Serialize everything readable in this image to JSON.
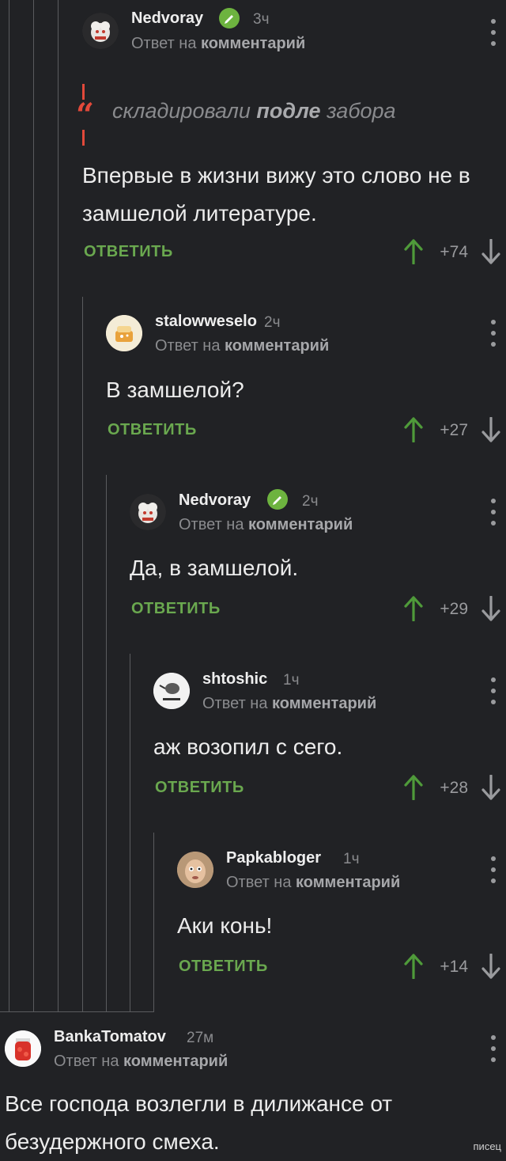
{
  "comments": [
    {
      "author": "Nedvoray",
      "time": "3ч",
      "reply_prefix": "Ответ на",
      "reply_target": "комментарий",
      "quote_pre": "складировали ",
      "quote_bold": "подле",
      "quote_post": " забора",
      "text": "Впервые в жизни вижу это слово не в замшелой литературе.",
      "reply_label": "ОТВЕТИТЬ",
      "score": "+74",
      "verified": true
    },
    {
      "author": "stalowweselo",
      "time": "2ч",
      "reply_prefix": "Ответ на",
      "reply_target": "комментарий",
      "text": "В замшелой?",
      "reply_label": "ОТВЕТИТЬ",
      "score": "+27"
    },
    {
      "author": "Nedvoray",
      "time": "2ч",
      "reply_prefix": "Ответ на",
      "reply_target": "комментарий",
      "text": "Да, в замшелой.",
      "reply_label": "ОТВЕТИТЬ",
      "score": "+29",
      "verified": true
    },
    {
      "author": "shtoshic",
      "time": "1ч",
      "reply_prefix": "Ответ на",
      "reply_target": "комментарий",
      "text": "аж возопил с сего.",
      "reply_label": "ОТВЕТИТЬ",
      "score": "+28"
    },
    {
      "author": "Papkabloger",
      "time": "1ч",
      "reply_prefix": "Ответ на",
      "reply_target": "комментарий",
      "text": "Аки конь!",
      "reply_label": "ОТВЕТИТЬ",
      "score": "+14"
    },
    {
      "author": "BankaTomatov",
      "time": "27м",
      "reply_prefix": "Ответ на",
      "reply_target": "комментарий",
      "text": "Все господа возлегли в дилижансе от безудержного смеха."
    }
  ],
  "watermark": "писец",
  "colors": {
    "background": "#212225",
    "accent_green": "#6aa84f",
    "upvote_green": "#4f9a3a",
    "quote_red": "#e2493a",
    "thread_line": "#5a5b5e"
  },
  "icons": [
    "verified-icon",
    "more-menu-icon",
    "upvote-arrow-icon",
    "downvote-arrow-icon",
    "quote-icon"
  ]
}
